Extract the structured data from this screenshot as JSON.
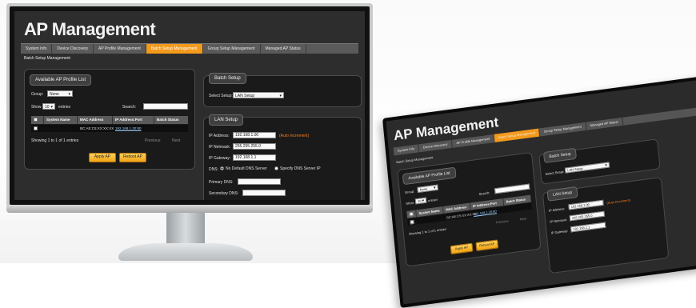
{
  "app": {
    "title": "AP Management",
    "page_title": "Batch Setup Management"
  },
  "tabs": [
    {
      "label": "System Info",
      "active": false
    },
    {
      "label": "Device Discovery",
      "active": false
    },
    {
      "label": "AP Profile Management",
      "active": false
    },
    {
      "label": "Batch Setup Management",
      "active": true
    },
    {
      "label": "Group Setup Management",
      "active": false
    },
    {
      "label": "Managed AP Status",
      "active": false
    }
  ],
  "available_profiles": {
    "heading": "Available AP Profile List",
    "group_label": "Group:",
    "group_value": "None",
    "show_label": "Show",
    "show_value": "10",
    "entries_label": "entries",
    "search_label": "Search:",
    "columns": [
      "System Name",
      "MAC Address",
      "IP Address:Port",
      "Batch Status"
    ],
    "rows": [
      {
        "system_name": "",
        "mac": "BC:AE:C5:XX:XX:XX",
        "ip": "192.168.1.20:80",
        "status": ""
      }
    ],
    "footer_info": "Showing 1 to 1 of 1 entries",
    "prev_label": "Previous",
    "next_label": "Next",
    "apply_button": "Apply AP",
    "reboot_button": "Reboot AP"
  },
  "batch_setup": {
    "heading": "Batch Setup",
    "select_label": "Select Setup:",
    "select_value": "LAN Setup"
  },
  "lan_setup": {
    "heading": "LAN Setup",
    "ip_label": "IP Address:",
    "ip_value": "192.168.1.00",
    "ip_note": "(Auto Increment)",
    "netmask_label": "IP Netmask:",
    "netmask_value": "255.255.255.0",
    "gateway_label": "IP Gateway:",
    "gateway_value": "192.168.1.1",
    "dns_label": "DNS:",
    "dns_option_1": "No Default DNS Server",
    "dns_option_2": "Specify DNS Server IP",
    "primary_dns_label": "Primary DNS:",
    "secondary_dns_label": "Secondary DNS:"
  },
  "colors": {
    "accent": "#f39a1c",
    "screen_bg": "#2d2d2d",
    "panel_bg": "#1a1a1a",
    "warning": "#ff7a1a"
  }
}
